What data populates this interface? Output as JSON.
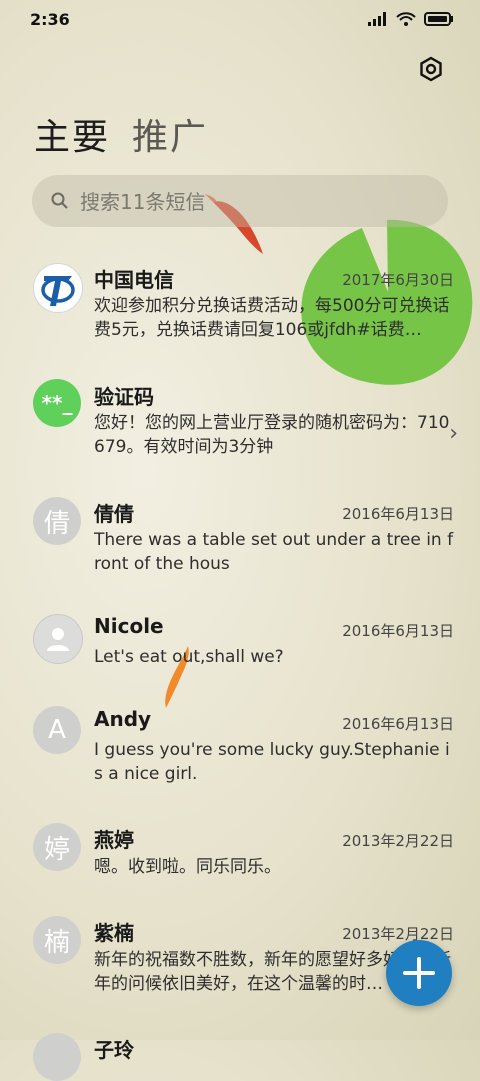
{
  "status": {
    "time": "2:36"
  },
  "tabs": [
    {
      "label": "主要"
    },
    {
      "label": "推广"
    }
  ],
  "search": {
    "placeholder": "搜索11条短信"
  },
  "messages": [
    {
      "name": "中国电信",
      "date": "2017年6月30日",
      "preview": "欢迎参加积分兑换话费活动，每500分可兑换话费5元，兑换话费请回复106或jfdh#话费…"
    },
    {
      "name": "验证码",
      "avatar_text": "**_",
      "preview": "您好！您的网上营业厅登录的随机密码为：710679。有效时间为3分钟"
    },
    {
      "name": "倩倩",
      "avatar_text": "倩",
      "date": "2016年6月13日",
      "preview": "There was a table set out under a tree in front of the hous"
    },
    {
      "name": "Nicole",
      "date": "2016年6月13日",
      "preview": "Let's eat out,shall we?"
    },
    {
      "name": "Andy",
      "avatar_text": "A",
      "date": "2016年6月13日",
      "preview": "I guess you're some lucky guy.Stephanie is a nice girl."
    },
    {
      "name": "燕婷",
      "avatar_text": "婷",
      "date": "2013年2月22日",
      "preview": "嗯。收到啦。同乐同乐。"
    },
    {
      "name": "紫楠",
      "avatar_text": "楠",
      "date": "2013年2月22日",
      "preview": "新年的祝福数不胜数，新年的愿望好多好多，新年的问候依旧美好，在这个温馨的时…"
    },
    {
      "name": "子玲"
    }
  ],
  "colors": {
    "accent": "#1f7fc1",
    "verify_avatar": "#5fd05a",
    "telecom_blue": "#1d5ea8"
  }
}
